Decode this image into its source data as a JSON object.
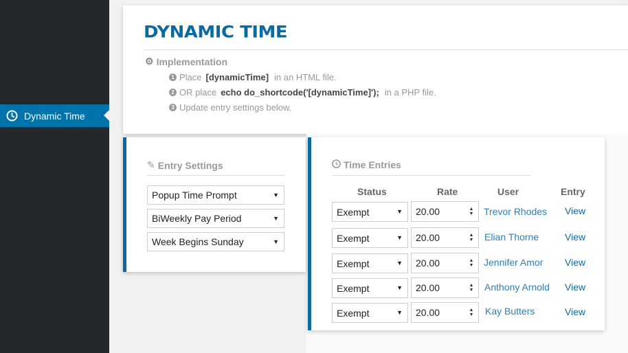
{
  "sidebar": {
    "active_item": "Dynamic Time",
    "icon": "clock-icon"
  },
  "header": {
    "logo_text": "DYNAMIC TIME",
    "implementation_title": "Implementation",
    "steps": [
      {
        "num": "1",
        "prefix": "Place",
        "code": "[dynamicTime]",
        "suffix": "in an HTML file."
      },
      {
        "num": "2",
        "prefix": "OR place",
        "code": "echo do_shortcode('[dynamicTime]');",
        "suffix": "in a PHP file."
      },
      {
        "num": "3",
        "prefix": "Update entry settings below.",
        "code": "",
        "suffix": ""
      }
    ]
  },
  "entry_settings": {
    "title": "Entry Settings",
    "selects": [
      "Popup Time Prompt",
      "BiWeekly Pay Period",
      "Week Begins Sunday"
    ]
  },
  "time_entries": {
    "title": "Time Entries",
    "columns": [
      "Status",
      "Rate",
      "User",
      "Entry"
    ],
    "rows": [
      {
        "status": "Exempt",
        "rate": "20.00",
        "user": "Trevor Rhodes",
        "entry": "View"
      },
      {
        "status": "Exempt",
        "rate": "20.00",
        "user": "Elian Thorne",
        "entry": "View"
      },
      {
        "status": "Exempt",
        "rate": "20.00",
        "user": "Jennifer Amor",
        "entry": "View"
      },
      {
        "status": "Exempt",
        "rate": "20.00",
        "user": "Anthony Arnold",
        "entry": "View"
      },
      {
        "status": "Exempt",
        "rate": "20.00",
        "user": "Kay Butters",
        "entry": "View"
      }
    ]
  },
  "colors": {
    "accent": "#0073aa",
    "sidebar_bg": "#23282d",
    "brand": "#0a6aa1"
  }
}
